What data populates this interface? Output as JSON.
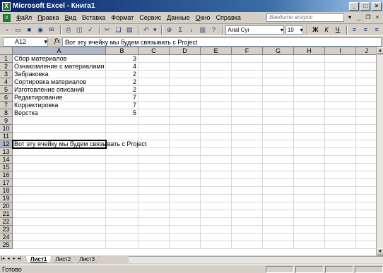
{
  "window": {
    "title": "Microsoft Excel - Книга1",
    "app_icon": "X"
  },
  "menu": {
    "items": [
      {
        "acc": "Ф",
        "rest": "айл"
      },
      {
        "acc": "П",
        "rest": "равка"
      },
      {
        "acc": "В",
        "rest": "ид"
      },
      {
        "acc": "",
        "rest": "Вставка"
      },
      {
        "acc": "",
        "rest": "Формат"
      },
      {
        "acc": "",
        "rest": "Сервис"
      },
      {
        "acc": "",
        "rest": "Данные"
      },
      {
        "acc": "О",
        "rest": "кно"
      },
      {
        "acc": "",
        "rest": "Справка"
      }
    ],
    "help_placeholder": "Введите вопрос"
  },
  "toolbar": {
    "font_name": "Arial Cyr",
    "font_size": "10",
    "bold": "Ж",
    "italic": "К",
    "underline": "Ч",
    "sum": "Σ",
    "zoom": "?"
  },
  "formula_bar": {
    "name_box": "A12",
    "fx": "fx",
    "content": "Вот эту ячейку мы будем связывать с Project"
  },
  "grid": {
    "columns": [
      "A",
      "B",
      "C",
      "D",
      "E",
      "F",
      "G",
      "H",
      "I",
      "J"
    ],
    "rows": [
      "1",
      "2",
      "3",
      "4",
      "5",
      "6",
      "7",
      "8",
      "9",
      "10",
      "11",
      "12",
      "13",
      "14",
      "15",
      "16",
      "17",
      "18",
      "19",
      "20",
      "21",
      "22",
      "23",
      "24",
      "25"
    ],
    "cells": [
      {
        "row": 1,
        "a": "Сбор материалов",
        "b": "3"
      },
      {
        "row": 2,
        "a": "Ознакомление с материалами",
        "b": "4"
      },
      {
        "row": 3,
        "a": "Забраковка",
        "b": "2"
      },
      {
        "row": 4,
        "a": "Сортировка материалов",
        "b": "2"
      },
      {
        "row": 5,
        "a": "Изготовление описаний",
        "b": "2"
      },
      {
        "row": 6,
        "a": "Редактирование",
        "b": "7"
      },
      {
        "row": 7,
        "a": "Корректировка",
        "b": "7"
      },
      {
        "row": 8,
        "a": "Верстка",
        "b": "5"
      },
      {
        "row": 12,
        "a": "Вот эту ячейку мы будем связывать с Project",
        "b": ""
      }
    ],
    "active_cell": "A12"
  },
  "sheets": {
    "tabs": [
      "Лист1",
      "Лист2",
      "Лист3"
    ],
    "active": 0
  },
  "status": {
    "text": "Готово"
  }
}
